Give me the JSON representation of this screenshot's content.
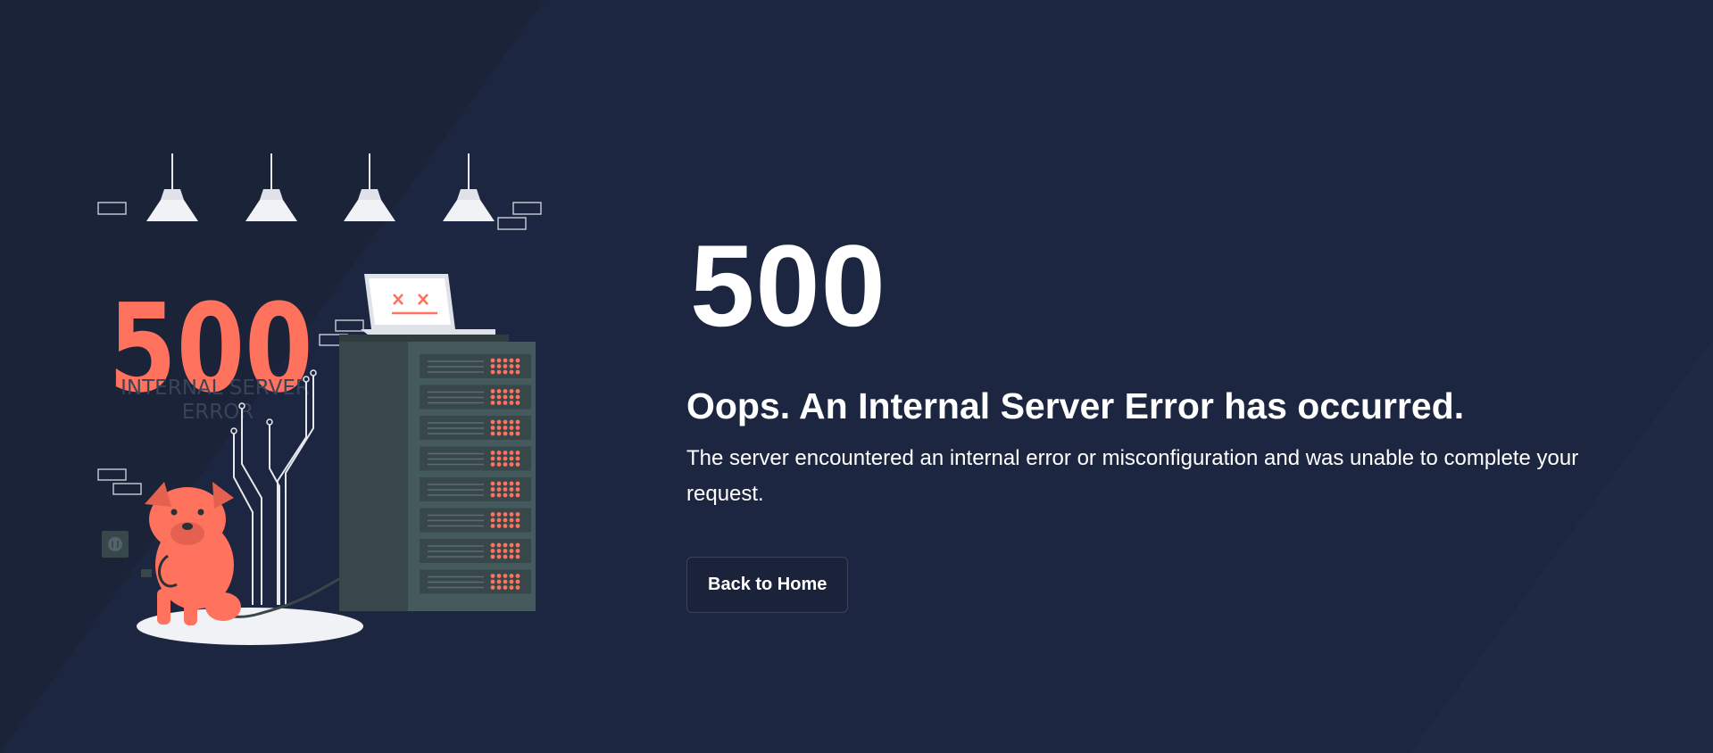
{
  "colors": {
    "background": "#1c2640",
    "accent": "#ff725e",
    "text": "#ffffff",
    "button_border": "#3a4459"
  },
  "illustration": {
    "big_number": "500",
    "caption_line1": "INTERNAL SERVER",
    "caption_line2": "ERROR"
  },
  "error": {
    "code": "500",
    "title": "Oops. An Internal Server Error has occurred.",
    "description": "The server encountered an internal error or misconfiguration and was unable to complete your request."
  },
  "actions": {
    "home_label": "Back to Home"
  }
}
